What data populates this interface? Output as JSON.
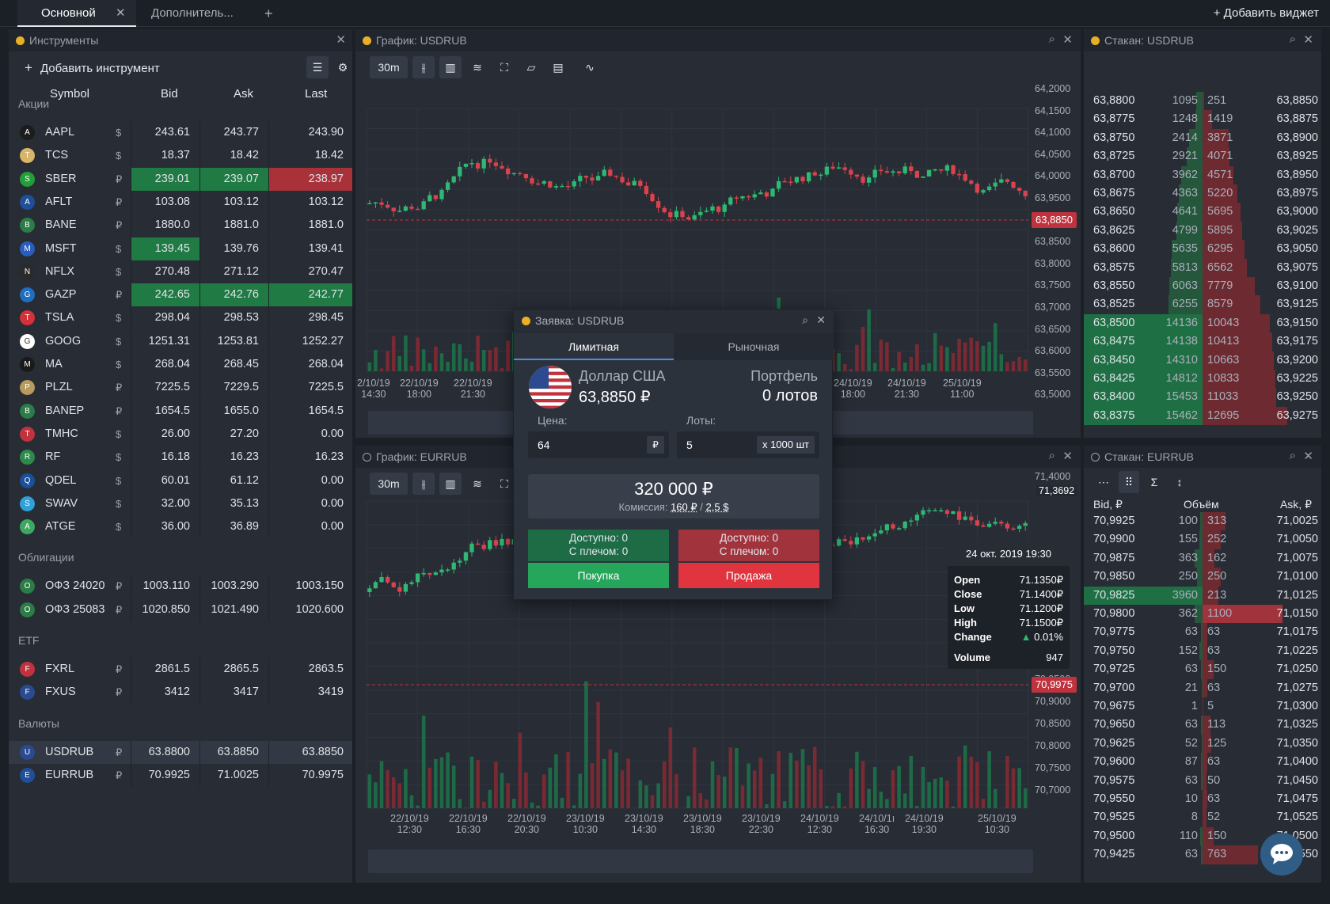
{
  "tabs": {
    "main": "Основной",
    "extra": "Дополнитель...",
    "add": "+"
  },
  "add_widget": "+ Добавить виджет",
  "instruments": {
    "title": "Инструменты",
    "add_label": "Добавить инструмент",
    "columns": [
      "Symbol",
      "Bid",
      "Ask",
      "Last"
    ],
    "groups": [
      {
        "name": "Акции",
        "rows": [
          {
            "sym": "AAPL",
            "cur": "$",
            "bid": "243.61",
            "ask": "243.77",
            "last": "243.90",
            "hl": [
              "",
              "",
              ""
            ]
          },
          {
            "sym": "TCS",
            "cur": "$",
            "bid": "18.37",
            "ask": "18.42",
            "last": "18.42",
            "hl": [
              "",
              "",
              ""
            ]
          },
          {
            "sym": "SBER",
            "cur": "₽",
            "bid": "239.01",
            "ask": "239.07",
            "last": "238.97",
            "hl": [
              "green",
              "green",
              "red"
            ]
          },
          {
            "sym": "AFLT",
            "cur": "₽",
            "bid": "103.08",
            "ask": "103.12",
            "last": "103.12",
            "hl": [
              "",
              "",
              ""
            ]
          },
          {
            "sym": "BANE",
            "cur": "₽",
            "bid": "1880.0",
            "ask": "1881.0",
            "last": "1881.0",
            "hl": [
              "",
              "",
              ""
            ]
          },
          {
            "sym": "MSFT",
            "cur": "$",
            "bid": "139.45",
            "ask": "139.76",
            "last": "139.41",
            "hl": [
              "green",
              "",
              ""
            ]
          },
          {
            "sym": "NFLX",
            "cur": "$",
            "bid": "270.48",
            "ask": "271.12",
            "last": "270.47",
            "hl": [
              "",
              "",
              ""
            ]
          },
          {
            "sym": "GAZP",
            "cur": "₽",
            "bid": "242.65",
            "ask": "242.76",
            "last": "242.77",
            "hl": [
              "green",
              "green",
              "green"
            ]
          },
          {
            "sym": "TSLA",
            "cur": "$",
            "bid": "298.04",
            "ask": "298.53",
            "last": "298.45",
            "hl": [
              "",
              "",
              ""
            ]
          },
          {
            "sym": "GOOG",
            "cur": "$",
            "bid": "1251.31",
            "ask": "1253.81",
            "last": "1252.27",
            "hl": [
              "",
              "",
              ""
            ]
          },
          {
            "sym": "MA",
            "cur": "$",
            "bid": "268.04",
            "ask": "268.45",
            "last": "268.04",
            "hl": [
              "",
              "",
              ""
            ]
          },
          {
            "sym": "PLZL",
            "cur": "₽",
            "bid": "7225.5",
            "ask": "7229.5",
            "last": "7225.5",
            "hl": [
              "",
              "",
              ""
            ]
          },
          {
            "sym": "BANEP",
            "cur": "₽",
            "bid": "1654.5",
            "ask": "1655.0",
            "last": "1654.5",
            "hl": [
              "",
              "",
              ""
            ]
          },
          {
            "sym": "TMHC",
            "cur": "$",
            "bid": "26.00",
            "ask": "27.20",
            "last": "0.00",
            "hl": [
              "",
              "",
              ""
            ]
          },
          {
            "sym": "RF",
            "cur": "$",
            "bid": "16.18",
            "ask": "16.23",
            "last": "16.23",
            "hl": [
              "",
              "",
              ""
            ]
          },
          {
            "sym": "QDEL",
            "cur": "$",
            "bid": "60.01",
            "ask": "61.12",
            "last": "0.00",
            "hl": [
              "",
              "",
              ""
            ]
          },
          {
            "sym": "SWAV",
            "cur": "$",
            "bid": "32.00",
            "ask": "35.13",
            "last": "0.00",
            "hl": [
              "",
              "",
              ""
            ]
          },
          {
            "sym": "ATGE",
            "cur": "$",
            "bid": "36.00",
            "ask": "36.89",
            "last": "0.00",
            "hl": [
              "",
              "",
              ""
            ]
          }
        ]
      },
      {
        "name": "Облигации",
        "rows": [
          {
            "sym": "ОФЗ 24020",
            "cur": "₽",
            "bid": "1003.110",
            "ask": "1003.290",
            "last": "1003.150",
            "hl": [
              "",
              "",
              ""
            ]
          },
          {
            "sym": "ОФЗ 25083",
            "cur": "₽",
            "bid": "1020.850",
            "ask": "1021.490",
            "last": "1020.600",
            "hl": [
              "",
              "",
              ""
            ]
          }
        ]
      },
      {
        "name": "ETF",
        "rows": [
          {
            "sym": "FXRL",
            "cur": "₽",
            "bid": "2861.5",
            "ask": "2865.5",
            "last": "2863.5",
            "hl": [
              "",
              "",
              ""
            ]
          },
          {
            "sym": "FXUS",
            "cur": "₽",
            "bid": "3412",
            "ask": "3417",
            "last": "3419",
            "hl": [
              "",
              "",
              ""
            ]
          }
        ]
      },
      {
        "name": "Валюты",
        "rows": [
          {
            "sym": "USDRUB",
            "cur": "₽",
            "bid": "63.8800",
            "ask": "63.8850",
            "last": "63.8850",
            "hl": [
              "",
              "",
              ""
            ]
          },
          {
            "sym": "EURRUB",
            "cur": "₽",
            "bid": "70.9925",
            "ask": "71.0025",
            "last": "70.9975",
            "hl": [
              "",
              "",
              ""
            ]
          }
        ]
      }
    ]
  },
  "chart1": {
    "title": "График: USDRUB",
    "interval": "30m",
    "price_tag": "63,8850",
    "y_ticks": [
      "64,2000",
      "64,1500",
      "64,1000",
      "64,0500",
      "64,0000",
      "63,9500",
      "63,9000",
      "63,8500",
      "63,8000",
      "63,7500",
      "63,7000",
      "63,6500",
      "63,6000",
      "63,5500",
      "63,5000"
    ],
    "x_ticks": [
      [
        "2/10/19",
        "14:30"
      ],
      [
        "22/10/19",
        "18:00"
      ],
      [
        "22/10/19",
        "21:30"
      ],
      [
        "24/10/19",
        "18:00"
      ],
      [
        "24/10/19",
        "21:30"
      ],
      [
        "25/10/19",
        "11:00"
      ]
    ]
  },
  "chart2": {
    "title": "График: EURRUB",
    "interval": "30m",
    "price_tag": "70,9975",
    "top_tag": "71,3692",
    "y_ticks": [
      "71,4000",
      "70,9500",
      "70,9000",
      "70,8500",
      "70,8000",
      "70,7500",
      "70,7000"
    ],
    "x_ticks": [
      [
        "22/10/19",
        "12:30"
      ],
      [
        "22/10/19",
        "16:30"
      ],
      [
        "22/10/19",
        "20:30"
      ],
      [
        "23/10/19",
        "10:30"
      ],
      [
        "23/10/19",
        "14:30"
      ],
      [
        "23/10/19",
        "18:30"
      ],
      [
        "23/10/19",
        "22:30"
      ],
      [
        "24/10/19",
        "12:30"
      ],
      [
        "24/10/1ı",
        "16:30"
      ],
      [
        "24/10/19",
        "19:30"
      ],
      [
        "25/10/19",
        "10:30"
      ]
    ],
    "tooltip": {
      "date": "24 окт. 2019 19:30",
      "open_l": "Open",
      "open": "71.1350₽",
      "close_l": "Close",
      "close": "71.1400₽",
      "low_l": "Low",
      "low": "71.1200₽",
      "high_l": "High",
      "high": "71.1500₽",
      "change_l": "Change",
      "change": "0.01%",
      "volume_l": "Volume",
      "volume": "947"
    }
  },
  "orderbook1": {
    "title": "Стакан: USDRUB",
    "rows": [
      [
        "63,8800",
        "1095",
        "251",
        "63,8850"
      ],
      [
        "63,8775",
        "1248",
        "1419",
        "63,8875"
      ],
      [
        "63,8750",
        "2414",
        "3871",
        "63,8900"
      ],
      [
        "63,8725",
        "2921",
        "4071",
        "63,8925"
      ],
      [
        "63,8700",
        "3962",
        "4571",
        "63,8950"
      ],
      [
        "63,8675",
        "4363",
        "5220",
        "63,8975"
      ],
      [
        "63,8650",
        "4641",
        "5695",
        "63,9000"
      ],
      [
        "63,8625",
        "4799",
        "5895",
        "63,9025"
      ],
      [
        "63,8600",
        "5635",
        "6295",
        "63,9050"
      ],
      [
        "63,8575",
        "5813",
        "6562",
        "63,9075"
      ],
      [
        "63,8550",
        "6063",
        "7779",
        "63,9100"
      ],
      [
        "63,8525",
        "6255",
        "8579",
        "63,9125"
      ],
      [
        "63,8500",
        "14136",
        "10043",
        "63,9150"
      ],
      [
        "63,8475",
        "14138",
        "10413",
        "63,9175"
      ],
      [
        "63,8450",
        "14310",
        "10663",
        "63,9200"
      ],
      [
        "63,8425",
        "14812",
        "10833",
        "63,9225"
      ],
      [
        "63,8400",
        "15453",
        "11033",
        "63,9250"
      ],
      [
        "63,8375",
        "15462",
        "12695",
        "63,9275"
      ]
    ]
  },
  "orderbook2": {
    "title": "Стакан: EURRUB",
    "headers": [
      "Bid, ₽",
      "Объём",
      "Ask, ₽"
    ],
    "rows": [
      [
        "70,9925",
        "100",
        "313",
        "71,0025"
      ],
      [
        "70,9900",
        "155",
        "252",
        "71,0050"
      ],
      [
        "70,9875",
        "363",
        "162",
        "71,0075"
      ],
      [
        "70,9850",
        "250",
        "250",
        "71,0100"
      ],
      [
        "70,9825",
        "3960",
        "213",
        "71,0125"
      ],
      [
        "70,9800",
        "362",
        "1100",
        "71,0150"
      ],
      [
        "70,9775",
        "63",
        "63",
        "71,0175"
      ],
      [
        "70,9750",
        "152",
        "63",
        "71,0225"
      ],
      [
        "70,9725",
        "63",
        "150",
        "71,0250"
      ],
      [
        "70,9700",
        "21",
        "63",
        "71,0275"
      ],
      [
        "70,9675",
        "1",
        "5",
        "71,0300"
      ],
      [
        "70,9650",
        "63",
        "113",
        "71,0325"
      ],
      [
        "70,9625",
        "52",
        "125",
        "71,0350"
      ],
      [
        "70,9600",
        "87",
        "63",
        "71,0400"
      ],
      [
        "70,9575",
        "63",
        "50",
        "71,0450"
      ],
      [
        "70,9550",
        "10",
        "63",
        "71,0475"
      ],
      [
        "70,9525",
        "8",
        "52",
        "71,0525"
      ],
      [
        "70,9500",
        "110",
        "150",
        "71,0500"
      ],
      [
        "70,9425",
        "63",
        "763",
        "71,0550"
      ]
    ]
  },
  "order": {
    "title": "Заявка: USDRUB",
    "tab_limit": "Лимитная",
    "tab_market": "Рыночная",
    "currency_name": "Доллар США",
    "currency_price": "63,8850 ₽",
    "portfolio_label": "Портфель",
    "portfolio_value": "0 лотов",
    "price_label": "Цена:",
    "lots_label": "Лоты:",
    "price_value": "64",
    "price_unit": "₽",
    "lots_value": "5",
    "lots_unit": "x 1000 шт",
    "total": "320 000 ₽",
    "commission_label": "Комиссия:",
    "commission_rub": "160 ₽",
    "commission_sep": "/",
    "commission_usd": "2,5 $",
    "buy_avail": "Доступно: 0",
    "buy_margin": "С плечом: 0",
    "sell_avail": "Доступно: 0",
    "sell_margin": "С плечом: 0",
    "buy": "Покупка",
    "sell": "Продажа"
  }
}
